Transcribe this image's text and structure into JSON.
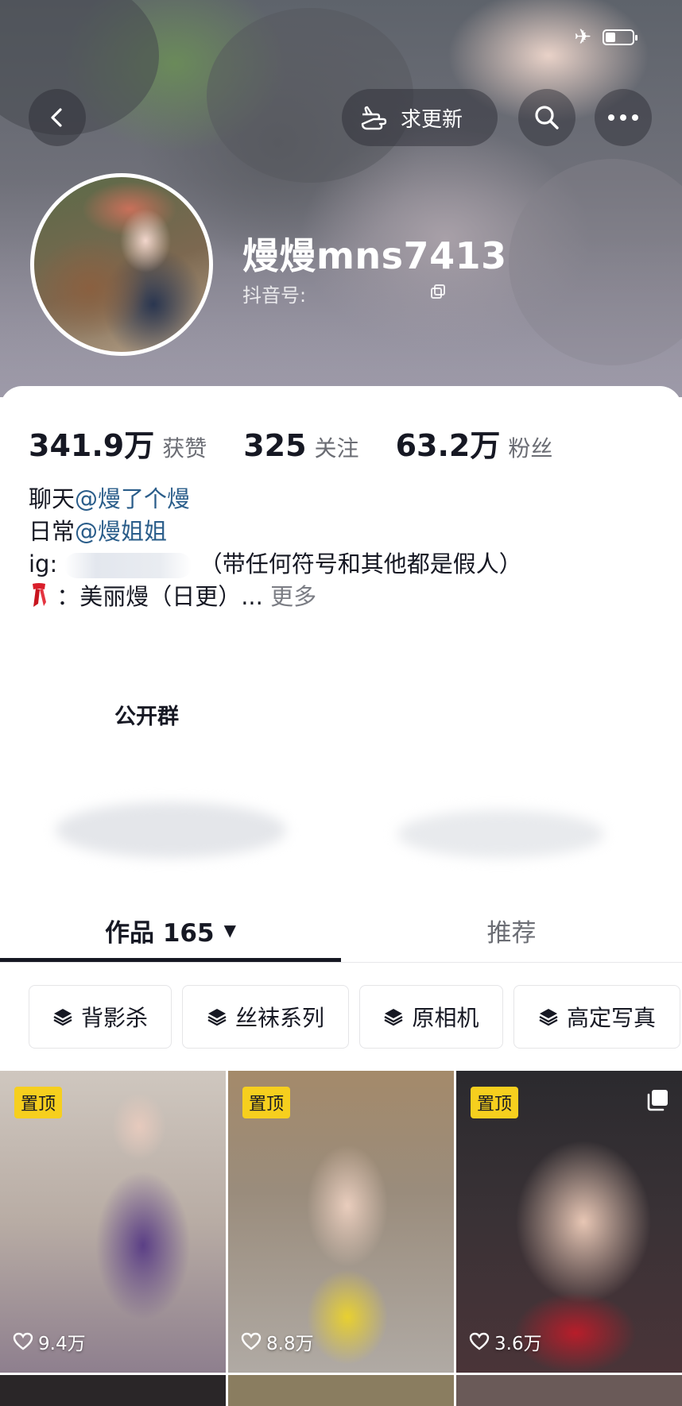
{
  "header": {
    "update_button": "求更新",
    "username": "熳熳mns7413",
    "douyin_id_label": "抖音号:"
  },
  "stats": [
    {
      "value": "341.9万",
      "label": "获赞"
    },
    {
      "value": "325",
      "label": "关注"
    },
    {
      "value": "63.2万",
      "label": "粉丝"
    }
  ],
  "bio": {
    "line1_prefix": "聊天",
    "line1_mention": "@熳了个熳",
    "line2_prefix": "日常",
    "line2_mention": "@熳姐姐",
    "line3_prefix": "ig:",
    "line3_suffix": "（带任何符号和其他都是假人）",
    "line4_text": "：美丽熳（日更）...",
    "line4_more": "更多"
  },
  "group": {
    "title": "公开群"
  },
  "tabs": {
    "works_label": "作品 165",
    "recommend_label": "推荐"
  },
  "collections": [
    "背影杀",
    "丝袜系列",
    "原相机",
    "高定写真"
  ],
  "videos": [
    {
      "pinned": "置顶",
      "likes": "9.4万"
    },
    {
      "pinned": "置顶",
      "likes": "8.8万"
    },
    {
      "pinned": "置顶",
      "likes": "3.6万"
    }
  ],
  "colors": {
    "accent_mention": "#2a5d8a",
    "pin_badge": "#f6cf1e"
  }
}
